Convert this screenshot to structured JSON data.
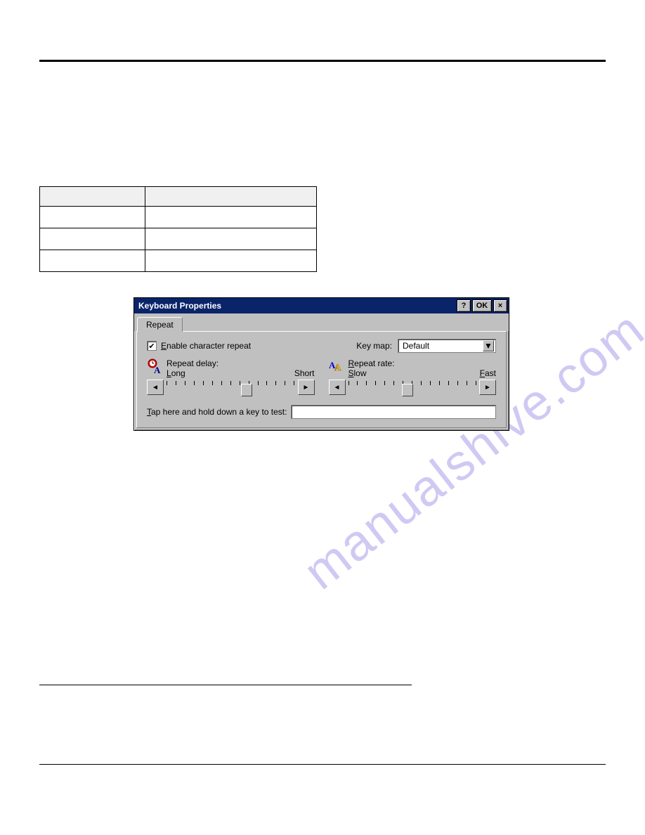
{
  "watermark": "manualshive.com",
  "dialog": {
    "title": "Keyboard Properties",
    "help_btn": "?",
    "ok_btn": "OK",
    "close_btn": "×",
    "tab_repeat": "Repeat",
    "enable_repeat_label": "Enable character repeat",
    "enable_repeat_checked": "✔",
    "keymap_label": "Key map:",
    "keymap_value": "Default",
    "repeat_delay_label": "Repeat delay:",
    "delay_long": "Long",
    "delay_short": "Short",
    "repeat_rate_label": "Repeat rate:",
    "rate_slow": "Slow",
    "rate_fast": "Fast",
    "arrow_left": "◄",
    "arrow_right": "►",
    "dropdown_arrow": "▼",
    "test_label": "Tap here and hold down a key to test:",
    "test_value": ""
  }
}
